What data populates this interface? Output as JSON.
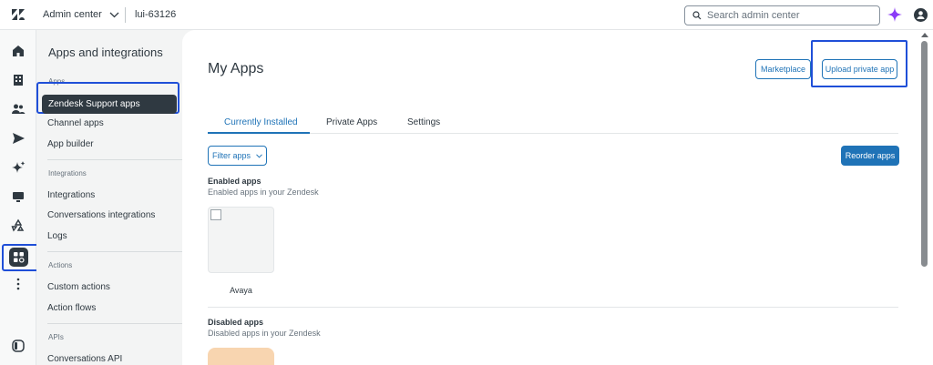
{
  "topbar": {
    "product": "Admin center",
    "account": "lui-63126",
    "search_placeholder": "Search admin center"
  },
  "subnav": {
    "title": "Apps and integrations",
    "groups": {
      "apps": "Apps",
      "integrations": "Integrations",
      "actions": "Actions",
      "apis": "APIs"
    },
    "items": {
      "zendesk_support_apps": "Zendesk Support apps",
      "channel_apps": "Channel apps",
      "app_builder": "App builder",
      "integrations": "Integrations",
      "conversations_integrations": "Conversations integrations",
      "logs": "Logs",
      "custom_actions": "Custom actions",
      "action_flows": "Action flows",
      "conversations_api": "Conversations API"
    }
  },
  "main": {
    "title": "My Apps",
    "marketplace_label": "Marketplace",
    "upload_label": "Upload private app",
    "tabs": [
      "Currently Installed",
      "Private Apps",
      "Settings"
    ],
    "filter_label": "Filter apps",
    "reorder_label": "Reorder apps",
    "enabled_title": "Enabled apps",
    "enabled_sub": "Enabled apps in your Zendesk",
    "app_name": "Avaya",
    "disabled_title": "Disabled apps",
    "disabled_sub": "Disabled apps in your Zendesk"
  },
  "icons": {
    "rail": [
      "home-icon",
      "building-icon",
      "people-icon",
      "send-icon",
      "sparkle-icon",
      "monitor-icon",
      "recycle-icon",
      "apps-grid-icon",
      "more-vertical-icon",
      "panel-toggle-icon"
    ]
  },
  "colors": {
    "accent": "#1f73b7",
    "dark": "#2f3941",
    "highlight": "#1f4fd8",
    "ai": "#8b3cf7"
  }
}
